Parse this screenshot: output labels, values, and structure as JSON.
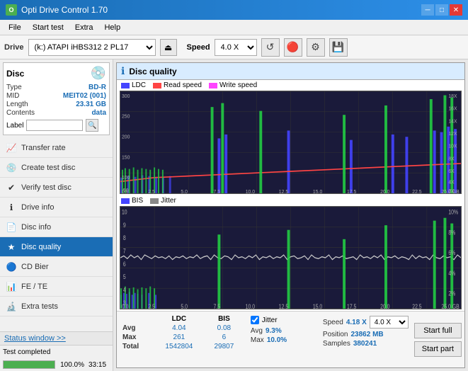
{
  "titleBar": {
    "title": "Opti Drive Control 1.70",
    "icon": "O",
    "buttons": [
      "minimize",
      "maximize",
      "close"
    ]
  },
  "menuBar": {
    "items": [
      "File",
      "Start test",
      "Extra",
      "Help"
    ]
  },
  "toolbar": {
    "driveLabel": "Drive",
    "driveValue": "(k:) ATAPI iHBS312  2 PL17",
    "speedLabel": "Speed",
    "speedValue": "4.0 X"
  },
  "sidebar": {
    "discPanel": {
      "header": "Disc",
      "rows": [
        {
          "label": "Type",
          "value": "BD-R"
        },
        {
          "label": "MID",
          "value": "MEIT02 (001)"
        },
        {
          "label": "Length",
          "value": "23.31 GB"
        },
        {
          "label": "Contents",
          "value": "data"
        },
        {
          "label": "Label",
          "value": ""
        }
      ]
    },
    "navItems": [
      {
        "id": "transfer-rate",
        "label": "Transfer rate",
        "icon": "📈"
      },
      {
        "id": "create-test-disc",
        "label": "Create test disc",
        "icon": "💿"
      },
      {
        "id": "verify-test-disc",
        "label": "Verify test disc",
        "icon": "✔"
      },
      {
        "id": "drive-info",
        "label": "Drive info",
        "icon": "ℹ"
      },
      {
        "id": "disc-info",
        "label": "Disc info",
        "icon": "📄"
      },
      {
        "id": "disc-quality",
        "label": "Disc quality",
        "icon": "★",
        "active": true
      },
      {
        "id": "cd-bier",
        "label": "CD Bier",
        "icon": "🔵"
      },
      {
        "id": "fe-te",
        "label": "FE / TE",
        "icon": "📊"
      },
      {
        "id": "extra-tests",
        "label": "Extra tests",
        "icon": "🔬"
      }
    ]
  },
  "discQuality": {
    "title": "Disc quality",
    "legend": {
      "ldc": {
        "label": "LDC",
        "color": "#4444ff"
      },
      "readSpeed": {
        "label": "Read speed",
        "color": "#ff4444"
      },
      "writeSpeed": {
        "label": "Write speed",
        "color": "#ff44ff"
      }
    },
    "topChart": {
      "yMax": 300,
      "yLabels": [
        "300",
        "250",
        "200",
        "150",
        "100",
        "50",
        "0.0"
      ],
      "yRightLabels": [
        "18X",
        "16X",
        "14X",
        "12X",
        "10X",
        "8X",
        "6X",
        "4X",
        "2X"
      ],
      "xLabels": [
        "0.0",
        "2.5",
        "5.0",
        "7.5",
        "10.0",
        "12.5",
        "15.0",
        "17.5",
        "20.0",
        "22.5",
        "25.0 GB"
      ]
    },
    "bisLegend": {
      "bis": {
        "label": "BIS",
        "color": "#4444ff"
      },
      "jitter": {
        "label": "Jitter",
        "color": "#888888"
      }
    },
    "bottomChart": {
      "yLabels": [
        "10",
        "9",
        "8",
        "7",
        "6",
        "5",
        "4",
        "3",
        "2",
        "1"
      ],
      "yRightLabels": [
        "10%",
        "8%",
        "6%",
        "4%",
        "2%"
      ],
      "xLabels": [
        "0.0",
        "2.5",
        "5.0",
        "7.5",
        "10.0",
        "12.5",
        "15.0",
        "17.5",
        "20.0",
        "22.5",
        "25.0 GB"
      ]
    }
  },
  "stats": {
    "columns": [
      "",
      "LDC",
      "BIS"
    ],
    "rows": [
      {
        "label": "Avg",
        "ldc": "4.04",
        "bis": "0.08"
      },
      {
        "label": "Max",
        "ldc": "261",
        "bis": "6"
      },
      {
        "label": "Total",
        "ldc": "1542804",
        "bis": "29807"
      }
    ],
    "jitter": {
      "label": "Jitter",
      "avg": "9.3%",
      "max": "10.0%",
      "checked": true
    },
    "speed": {
      "label": "Speed",
      "value": "4.18 X",
      "selectValue": "4.0 X"
    },
    "position": {
      "label": "Position",
      "value": "23862 MB"
    },
    "samples": {
      "label": "Samples",
      "value": "380241"
    },
    "buttons": {
      "startFull": "Start full",
      "startPart": "Start part"
    }
  },
  "statusBar": {
    "statusWindowLabel": "Status window >>",
    "statusText": "Test completed",
    "progressValue": 100,
    "progressText": "100.0%",
    "timeText": "33:15"
  }
}
